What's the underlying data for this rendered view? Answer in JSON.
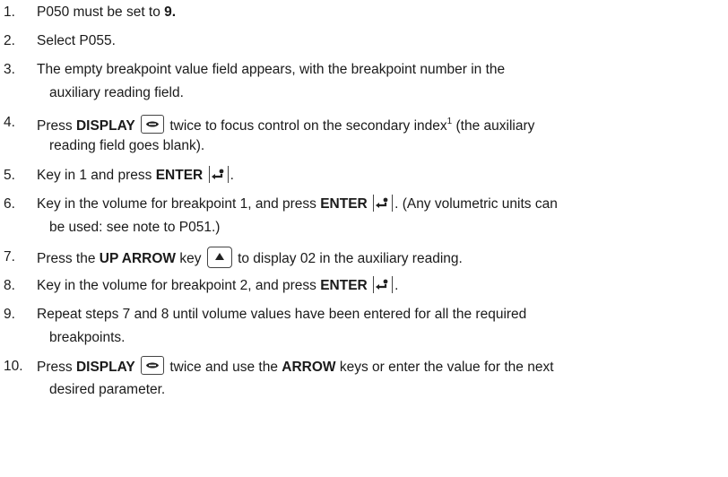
{
  "steps": [
    {
      "num": "1.",
      "parts": [
        "P050 must be set to ",
        "9."
      ]
    },
    {
      "num": "2.",
      "text": "Select P055."
    },
    {
      "num": "3.",
      "line1": "The empty breakpoint value field appears, with the breakpoint number in the",
      "line2": "auxiliary reading field."
    },
    {
      "num": "4.",
      "pre": "Press ",
      "key": "DISPLAY",
      "mid": " twice to focus control on the secondary index",
      "sup": "1",
      "post": " (the auxiliary",
      "line2": "reading field goes blank)."
    },
    {
      "num": "5.",
      "pre": "Key in 1 and press ",
      "key": "ENTER",
      "post": "."
    },
    {
      "num": "6.",
      "pre": "Key in the volume for breakpoint 1, and press ",
      "key": "ENTER",
      "post": ". (Any volumetric units can",
      "line2": "be used: see note to P051.)"
    },
    {
      "num": "7.",
      "pre": "Press the ",
      "key": "UP ARROW",
      "mid": " key ",
      "post": " to display 02 in the auxiliary reading."
    },
    {
      "num": "8.",
      "pre": "Key in the volume for breakpoint 2, and press ",
      "key": "ENTER",
      "post": "."
    },
    {
      "num": "9.",
      "line1": "Repeat steps 7 and 8 until volume values have been entered for all the required",
      "line2": "breakpoints."
    },
    {
      "num": "10.",
      "pre": "Press ",
      "key": "DISPLAY",
      "mid": " twice and use the ",
      "key2": "ARROW",
      "post": " keys or enter the value for the next",
      "line2": "desired parameter."
    }
  ],
  "icons": {
    "display": "display-key-icon",
    "enter": "enter-key-icon",
    "up": "up-arrow-key-icon"
  }
}
